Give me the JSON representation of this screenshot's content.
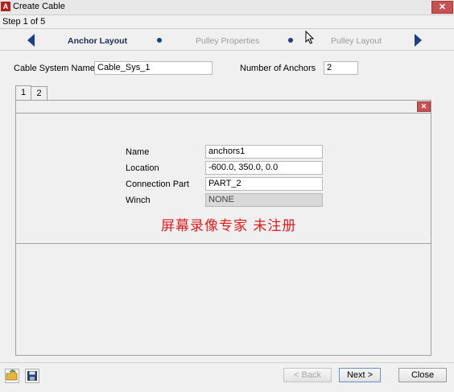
{
  "window": {
    "app_icon_letter": "A",
    "title": "Create Cable",
    "close_glyph": "✕"
  },
  "wizard": {
    "step_text": "Step 1 of 5",
    "steps": [
      "Anchor Layout",
      "Pulley Properties",
      "Pulley Layout"
    ],
    "active_step": "Anchor Layout",
    "accent_color": "#1a3e8c"
  },
  "form": {
    "cable_system_name_label": "Cable System Name",
    "cable_system_name_value": "Cable_Sys_1",
    "number_of_anchors_label": "Number of Anchors",
    "number_of_anchors_value": "2"
  },
  "tabs": [
    "1",
    "2"
  ],
  "panel": {
    "close_glyph": "✕",
    "fields": [
      {
        "label": "Name",
        "value": "anchors1"
      },
      {
        "label": "Location",
        "value": "-600.0, 350.0, 0.0"
      },
      {
        "label": "Connection Part",
        "value": "PART_2"
      },
      {
        "label": "Winch",
        "value": "NONE"
      }
    ],
    "overlay_text": "屏幕录像专家  未注册"
  },
  "buttons": {
    "back": "< Back",
    "next": "Next >",
    "close": "Close"
  },
  "toolbar_icons": [
    "open-folder-icon",
    "save-disk-icon"
  ]
}
